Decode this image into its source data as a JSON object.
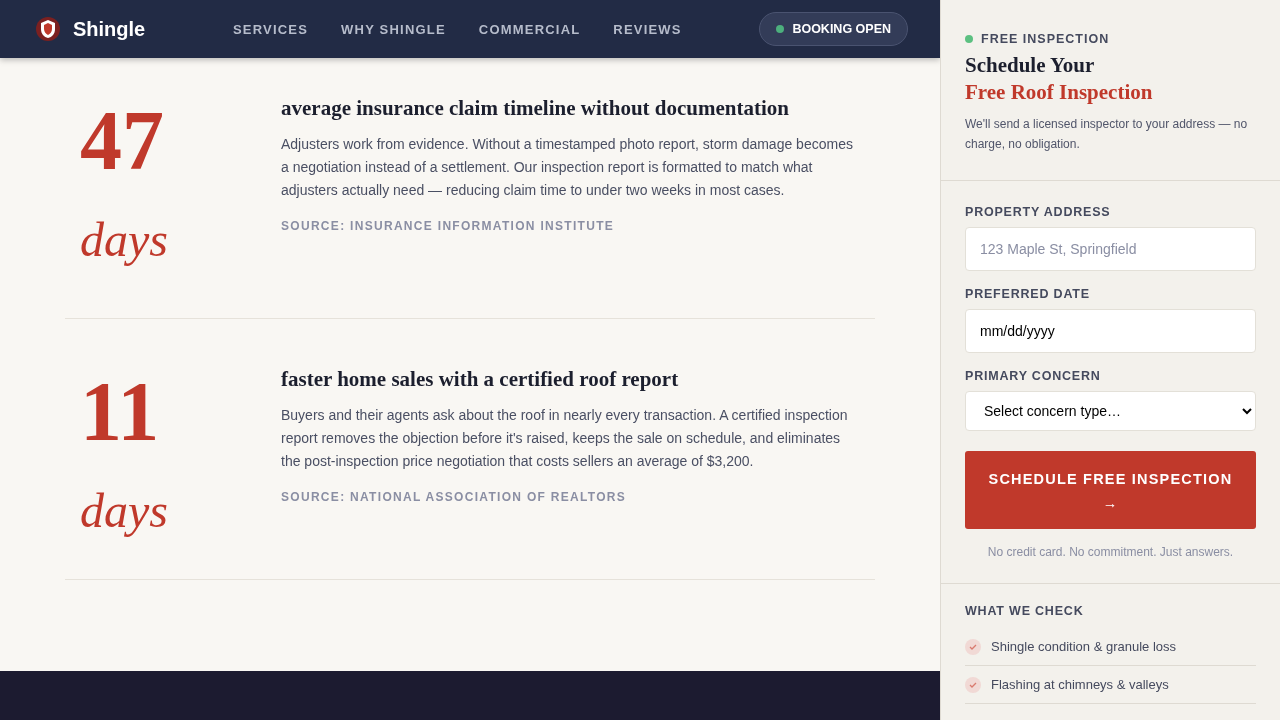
{
  "header": {
    "brand": "Shingle",
    "nav": [
      {
        "label": "SERVICES"
      },
      {
        "label": "WHY SHINGLE"
      },
      {
        "label": "COMMERCIAL"
      },
      {
        "label": "REVIEWS"
      }
    ],
    "status": {
      "label": "BOOKING OPEN",
      "color": "#4caf7d"
    }
  },
  "stats": [
    {
      "number": "47",
      "unit": "days",
      "title": "average insurance claim timeline without documentation",
      "body": "Adjusters work from evidence. Without a timestamped photo report, storm damage becomes a negotiation instead of a settlement. Our inspection report is formatted to match what adjusters actually need — reducing claim time to under two weeks in most cases.",
      "source": "SOURCE: INSURANCE INFORMATION INSTITUTE"
    },
    {
      "number": "11",
      "unit": "days",
      "title": "faster home sales with a certified roof report",
      "body": "Buyers and their agents ask about the roof in nearly every transaction. A certified inspection report removes the objection before it's raised, keeps the sale on schedule, and eliminates the post-inspection price negotiation that costs sellers an average of $3,200.",
      "source": "SOURCE: NATIONAL ASSOCIATION OF REALTORS"
    }
  ],
  "sidebar": {
    "eyebrow": {
      "label": "FREE INSPECTION",
      "color": "#5cc081"
    },
    "title_line1": "Schedule Your",
    "title_line2": "Free Roof Inspection",
    "intro": "We'll send a licensed inspector to your address — no charge, no obligation.",
    "fields": [
      {
        "kind": "text",
        "label": "PROPERTY ADDRESS",
        "placeholder": "123 Maple St, Springfield"
      },
      {
        "kind": "date",
        "label": "PREFERRED DATE",
        "value": "mm/dd/yyyy"
      },
      {
        "kind": "select",
        "label": "PRIMARY CONCERN",
        "value": "Select concern type…"
      }
    ],
    "submit": {
      "label": "SCHEDULE FREE INSPECTION",
      "arrow": "→"
    },
    "note": "No credit card. No commitment. Just answers.",
    "checklist_title": "WHAT WE CHECK",
    "checklist": [
      {
        "label": "Shingle condition & granule loss"
      },
      {
        "label": "Flashing at chimneys & valleys"
      }
    ]
  }
}
